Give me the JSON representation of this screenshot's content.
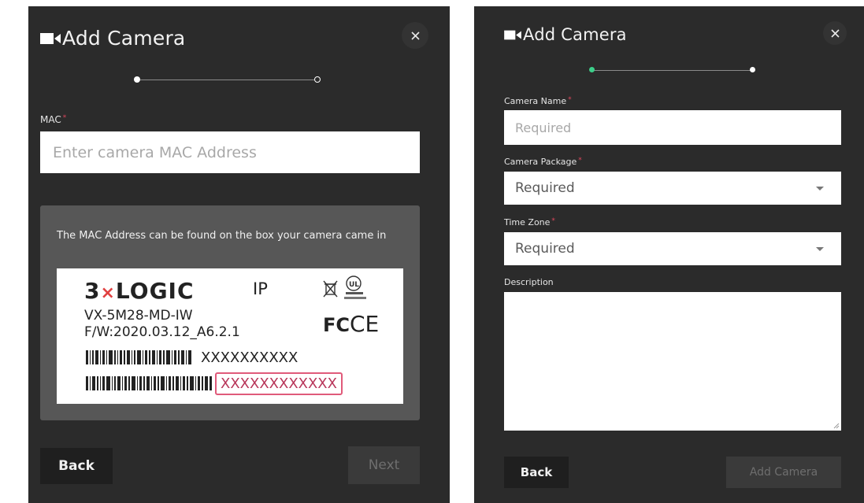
{
  "mac_step": {
    "title": "Add Camera",
    "close_icon": "close-icon",
    "mac_label": "MAC",
    "required_mark": "*",
    "mac_placeholder": "Enter camera MAC Address",
    "help_text": "The MAC Address can be found on the box your camera came in",
    "label_card": {
      "brand_prefix": "3",
      "brand_x": "×",
      "brand_name": "LOGIC",
      "ip": "IP",
      "model": "VX-5M28-MD-IW",
      "firmware": "F/W:2020.03.12_A6.2.1",
      "serial": "XXXXXXXXXX",
      "mac": "XXXXXXXXXXXX",
      "cert_marks": [
        "recycle-bin-icon",
        "ul-listed-icon",
        "fcc-icon",
        "ce-icon"
      ]
    },
    "back_label": "Back",
    "next_label": "Next"
  },
  "details_step": {
    "title": "Add Camera",
    "close_icon": "close-icon",
    "camera_name_label": "Camera Name",
    "camera_name_placeholder": "Required",
    "camera_package_label": "Camera Package",
    "camera_package_value": "Required",
    "time_zone_label": "Time Zone",
    "time_zone_value": "Required",
    "description_label": "Description",
    "required_mark": "*",
    "back_label": "Back",
    "add_label": "Add Camera"
  },
  "colors": {
    "panel_bg": "#2b2b2b",
    "required": "#e0475d",
    "step_active": "#3ccf8a",
    "highlight_box": "#e05a7a"
  }
}
